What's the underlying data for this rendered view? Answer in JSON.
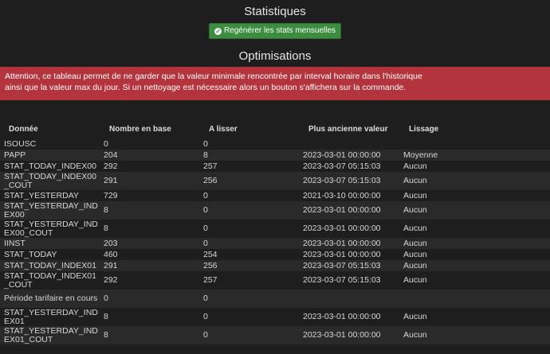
{
  "header": {
    "title": "Statistiques",
    "regen_button_label": "Regénérer les stats mensuelles",
    "section_title": "Optimisations"
  },
  "alert": {
    "line1": "Attention, ce tableau permet de ne garder que la valeur minimale rencontrée par interval horaire dans l'historique",
    "line2": "ainsi que la valeur max du jour. Si un nettoyage est nécessaire alors un bouton s'affichera sur la commande."
  },
  "table": {
    "headers": [
      "Donnée",
      "Nombre en base",
      "A lisser",
      "Plus ancienne valeur",
      "Lissage"
    ],
    "rows": [
      [
        "ISOUSC",
        "0",
        "0",
        "",
        ""
      ],
      [
        "PAPP",
        "204",
        "8",
        "2023-03-01 00:00:00",
        "Moyenne"
      ],
      [
        "STAT_TODAY_INDEX00",
        "292",
        "257",
        "2023-03-07 05:15:03",
        "Aucun"
      ],
      [
        "STAT_TODAY_INDEX00_COUT",
        "291",
        "256",
        "2023-03-07 05:15:03",
        "Aucun"
      ],
      [
        "STAT_YESTERDAY",
        "729",
        "0",
        "2021-03-10 00:00:00",
        "Aucun"
      ],
      [
        "STAT_YESTERDAY_INDEX00",
        "8",
        "0",
        "2023-03-01 00:00:00",
        "Aucun"
      ],
      [
        "STAT_YESTERDAY_INDEX00_COUT",
        "8",
        "0",
        "2023-03-01 00:00:00",
        "Aucun"
      ],
      [
        "IINST",
        "203",
        "0",
        "2023-03-01 00:00:00",
        "Aucun"
      ],
      [
        "STAT_TODAY",
        "460",
        "254",
        "2023-03-01 00:00:00",
        "Aucun"
      ],
      [
        "STAT_TODAY_INDEX01",
        "291",
        "256",
        "2023-03-07 05:15:03",
        "Aucun"
      ],
      [
        "STAT_TODAY_INDEX01_COUT",
        "292",
        "257",
        "2023-03-07 05:15:03",
        "Aucun"
      ],
      [
        "Période tarifaire en cours",
        "0",
        "0",
        "",
        ""
      ],
      [
        "STAT_YESTERDAY_INDEX01",
        "8",
        "0",
        "2023-03-01 00:00:00",
        "Aucun"
      ],
      [
        "STAT_YESTERDAY_INDEX01_COUT",
        "8",
        "0",
        "2023-03-01 00:00:00",
        "Aucun"
      ]
    ]
  }
}
